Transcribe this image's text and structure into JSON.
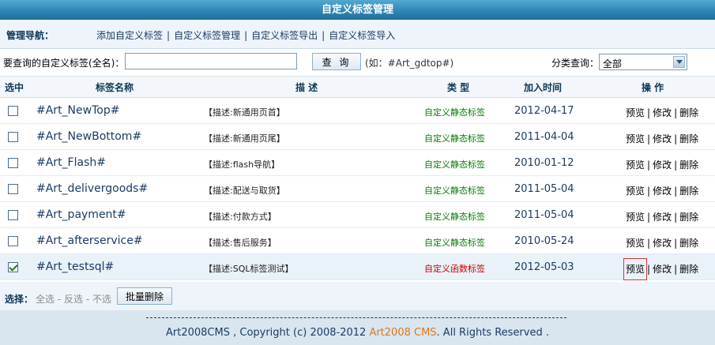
{
  "title": "自定义标签管理",
  "nav": {
    "label": "管理导航：",
    "links": [
      "添加自定义标签",
      "自定义标签管理",
      "自定义标签导出",
      "自定义标签导入"
    ],
    "separator": "|"
  },
  "search": {
    "label": "要查询的自定义标签(全名)：",
    "value": "",
    "button": "查 询",
    "hint": "(如：#Art_gdtop#)",
    "category_label": "分类查询：",
    "category_value": "全部"
  },
  "table": {
    "headers": [
      "选中",
      "标签名称",
      "描 述",
      "类 型",
      "加入时间",
      "操 作"
    ],
    "rows": [
      {
        "checked": false,
        "name": "#Art_NewTop#",
        "desc": "【描述:新通用页首】",
        "type": "自定义静态标签",
        "date": "2012-04-17"
      },
      {
        "checked": false,
        "name": "#Art_NewBottom#",
        "desc": "【描述:新通用页尾】",
        "type": "自定义静态标签",
        "date": "2011-04-04"
      },
      {
        "checked": false,
        "name": "#Art_Flash#",
        "desc": "【描述:flash导航】",
        "type": "自定义静态标签",
        "date": "2010-01-12"
      },
      {
        "checked": false,
        "name": "#Art_delivergoods#",
        "desc": "【描述:配送与取货】",
        "type": "自定义静态标签",
        "date": "2011-05-04"
      },
      {
        "checked": false,
        "name": "#Art_payment#",
        "desc": "【描述:付款方式】",
        "type": "自定义静态标签",
        "date": "2011-05-04"
      },
      {
        "checked": false,
        "name": "#Art_afterservice#",
        "desc": "【描述:售后服务】",
        "type": "自定义静态标签",
        "date": "2010-05-24"
      },
      {
        "checked": true,
        "name": "#Art_testsql#",
        "desc": "【描述:SQL标签测试】",
        "type": "自定义函数标签",
        "date": "2012-05-03"
      }
    ],
    "ops": {
      "preview": "预览",
      "edit": "修改",
      "delete": "删除",
      "separator": "|"
    }
  },
  "selection": {
    "label": "选择：",
    "all": "全选",
    "invert": "反选",
    "none": "不选",
    "separator": "-",
    "batch_delete": "批量删除"
  },
  "footer": {
    "prefix": "Art2008CMS , Copyright (c) 2008-2012 ",
    "brand": "Art2008 CMS",
    "suffix": ". All Rights Reserved ."
  },
  "colors": {
    "title_bar": "#2f86b5",
    "static_type": "#0a7a0a",
    "function_type": "#cc0000",
    "brand": "#e0771a",
    "highlight_outline": "#d23a3a"
  }
}
